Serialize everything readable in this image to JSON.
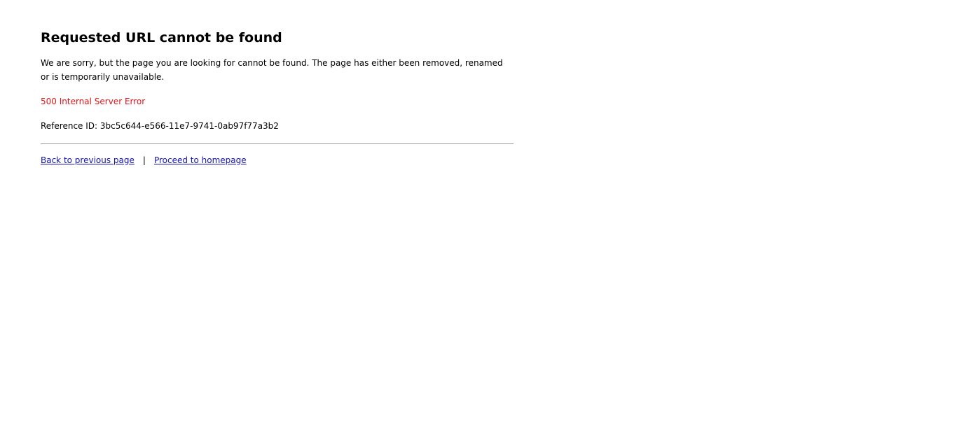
{
  "page": {
    "title": "Requested URL cannot be found",
    "description": "We are sorry, but the page you are looking for cannot be found. The page has either been removed, renamed or is temporarily unavailable.",
    "error_text": "500 Internal Server Error",
    "reference_label": "Reference ID:",
    "reference_id": "3bc5c644-e566-11e7-9741-0ab97f77a3b2"
  },
  "links": {
    "back_label": "Back to previous page",
    "separator": "|",
    "home_label": "Proceed to homepage"
  },
  "colors": {
    "error": "#e0161b",
    "link": "#1515b0",
    "rule": "#9a9a9a"
  }
}
